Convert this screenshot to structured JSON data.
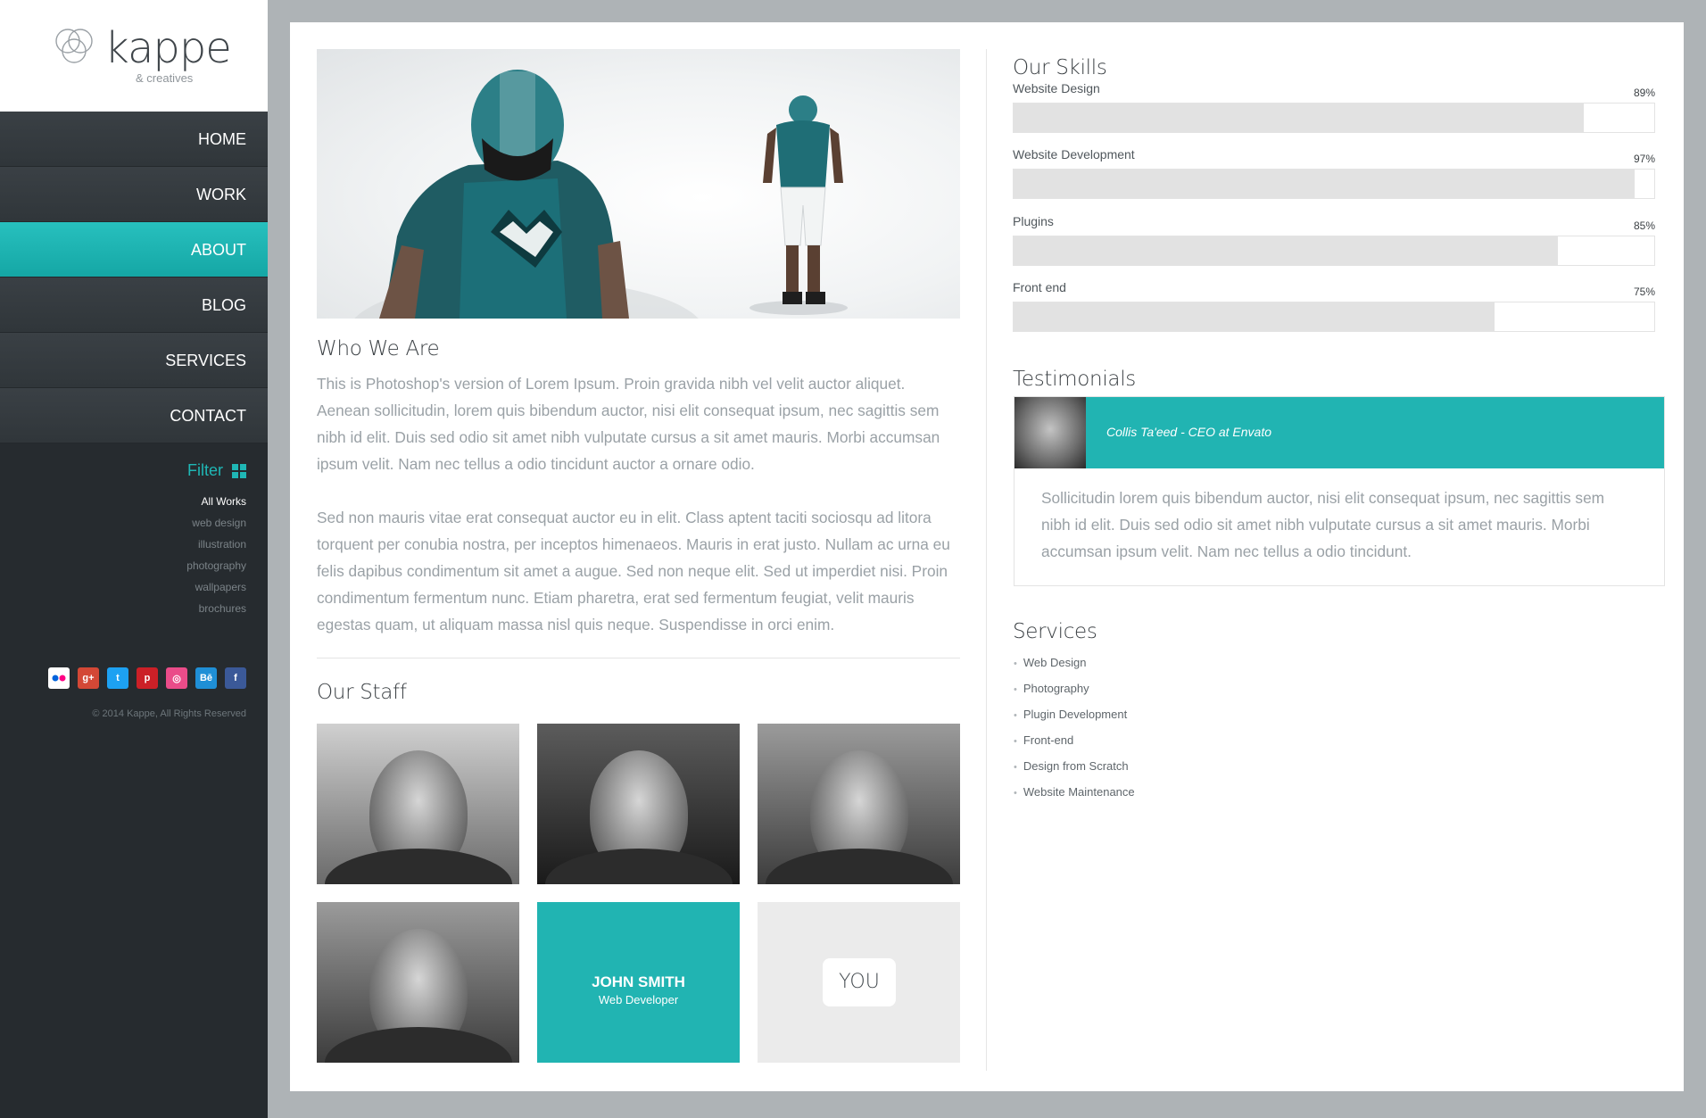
{
  "brand": {
    "name": "kappe",
    "sub": "& creatives"
  },
  "nav": {
    "items": [
      "HOME",
      "WORK",
      "ABOUT",
      "BLOG",
      "SERVICES",
      "CONTACT"
    ],
    "active": "ABOUT"
  },
  "filter": {
    "title": "Filter",
    "items": [
      "All Works",
      "web design",
      "illustration",
      "photography",
      "wallpapers",
      "brochures"
    ],
    "active": "All Works"
  },
  "social": [
    "flickr-icon",
    "google-plus-icon",
    "twitter-icon",
    "pinterest-icon",
    "dribbble-icon",
    "behance-icon",
    "facebook-icon"
  ],
  "copyright": "© 2014 Kappe, All Rights Reserved",
  "about": {
    "title": "Who We Are",
    "paragraph1": "This is Photoshop's version  of Lorem Ipsum. Proin gravida nibh vel velit auctor aliquet. Aenean sollicitudin, lorem quis bibendum auctor, nisi elit consequat ipsum, nec sagittis sem nibh id elit. Duis sed odio sit amet nibh vulputate cursus a sit amet mauris. Morbi accumsan ipsum velit. Nam nec tellus a odio tincidunt auctor a ornare odio.",
    "paragraph2": "Sed non  mauris vitae erat consequat auctor eu in elit. Class aptent taciti sociosqu ad litora torquent per conubia nostra, per inceptos himenaeos. Mauris in erat justo. Nullam ac urna eu felis dapibus condimentum sit amet a augue. Sed non neque elit. Sed ut imperdiet nisi. Proin condimentum fermentum nunc. Etiam pharetra, erat sed fermentum feugiat, velit mauris egestas quam, ut aliquam massa nisl quis neque. Suspendisse in orci enim."
  },
  "staff": {
    "title": "Our Staff",
    "featured": {
      "name": "JOHN SMITH",
      "role": "Web Developer"
    },
    "you_label": "YOU"
  },
  "skills": {
    "title": "Our Skills",
    "items": [
      {
        "label": "Website Design",
        "percent_text": "89%",
        "value": 89
      },
      {
        "label": "Website Development",
        "percent_text": "97%",
        "value": 97
      },
      {
        "label": "Plugins",
        "percent_text": "85%",
        "value": 85
      },
      {
        "label": "Front end",
        "percent_text": "75%",
        "value": 75
      }
    ]
  },
  "testimonials": {
    "title": "Testimonials",
    "author": "Collis Ta'eed - CEO at Envato",
    "quote": "Sollicitudin lorem quis bibendum auctor, nisi elit consequat ipsum, nec sagittis sem nibh id elit. Duis sed odio sit amet nibh vulputate cursus a sit amet mauris. Morbi accumsan ipsum velit. Nam nec tellus a odio tincidunt."
  },
  "services": {
    "title": "Services",
    "items": [
      "Web Design",
      "Photography",
      "Plugin Development",
      "Front-end",
      "Design from Scratch",
      "Website Maintenance"
    ]
  },
  "colors": {
    "accent": "#21b4b2",
    "sidebar": "#262b2f",
    "background": "#aeb3b6"
  }
}
